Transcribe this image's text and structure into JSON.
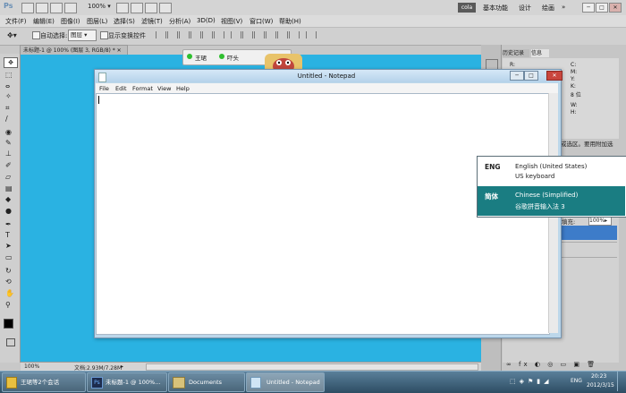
{
  "photoshop": {
    "logo": "Ps",
    "zoom": "100%",
    "user": "cola",
    "workspace": [
      "基本功能",
      "设计",
      "绘画"
    ],
    "window_controls": [
      "─",
      "□",
      "✕"
    ],
    "menu": [
      "文件(F)",
      "编辑(E)",
      "图像(I)",
      "图层(L)",
      "选择(S)",
      "滤镜(T)",
      "分析(A)",
      "3D(D)",
      "视图(V)",
      "窗口(W)",
      "帮助(H)"
    ],
    "options": {
      "auto_select_label": "自动选择:",
      "auto_select_value": "图层",
      "show_transform_label": "显示变换控件"
    },
    "doc_tab": "未标题-1 @ 100% (图层 3, RGB/8) *",
    "status": {
      "zoom": "100%",
      "doc_info": "文档:2.93M/7.28M"
    },
    "panels": {
      "tabs": [
        "历史记录",
        "信息"
      ],
      "info_rows": [
        "R:",
        "G:",
        "B:",
        "8 位",
        "C:",
        "M:",
        "Y:",
        "K:",
        "8 位",
        "X:",
        "Y:",
        "W:",
        "H:"
      ],
      "hint": "或选区。要用附加选",
      "fill_label": "填充:",
      "fill_value": "100%"
    }
  },
  "chat": {
    "tabs": [
      "王珺",
      "吓头"
    ]
  },
  "notepad": {
    "title": "Untitled - Notepad",
    "menu": [
      "File",
      "Edit",
      "Format",
      "View",
      "Help"
    ],
    "content": "",
    "controls": [
      "─",
      "□",
      "✕"
    ]
  },
  "ime_popup": {
    "items": [
      {
        "code": "ENG",
        "line1": "English (United States)",
        "line2": "US keyboard",
        "selected": false
      },
      {
        "code": "简体",
        "line1": "Chinese (Simplified)",
        "line2": "谷歌拼音输入法 3",
        "selected": true
      }
    ]
  },
  "taskbar": {
    "buttons": [
      {
        "label": "王珺等2个会话",
        "icon": "chat-folder-icon",
        "active": false
      },
      {
        "label": "未标题-1 @ 100%...",
        "icon": "photoshop-icon",
        "active": false
      },
      {
        "label": "Documents",
        "icon": "folder-icon",
        "active": false
      },
      {
        "label": "Untitled - Notepad",
        "icon": "notepad-icon",
        "active": true
      }
    ],
    "lang": "ENG",
    "time": "20:23",
    "date": "2012/3/15"
  }
}
